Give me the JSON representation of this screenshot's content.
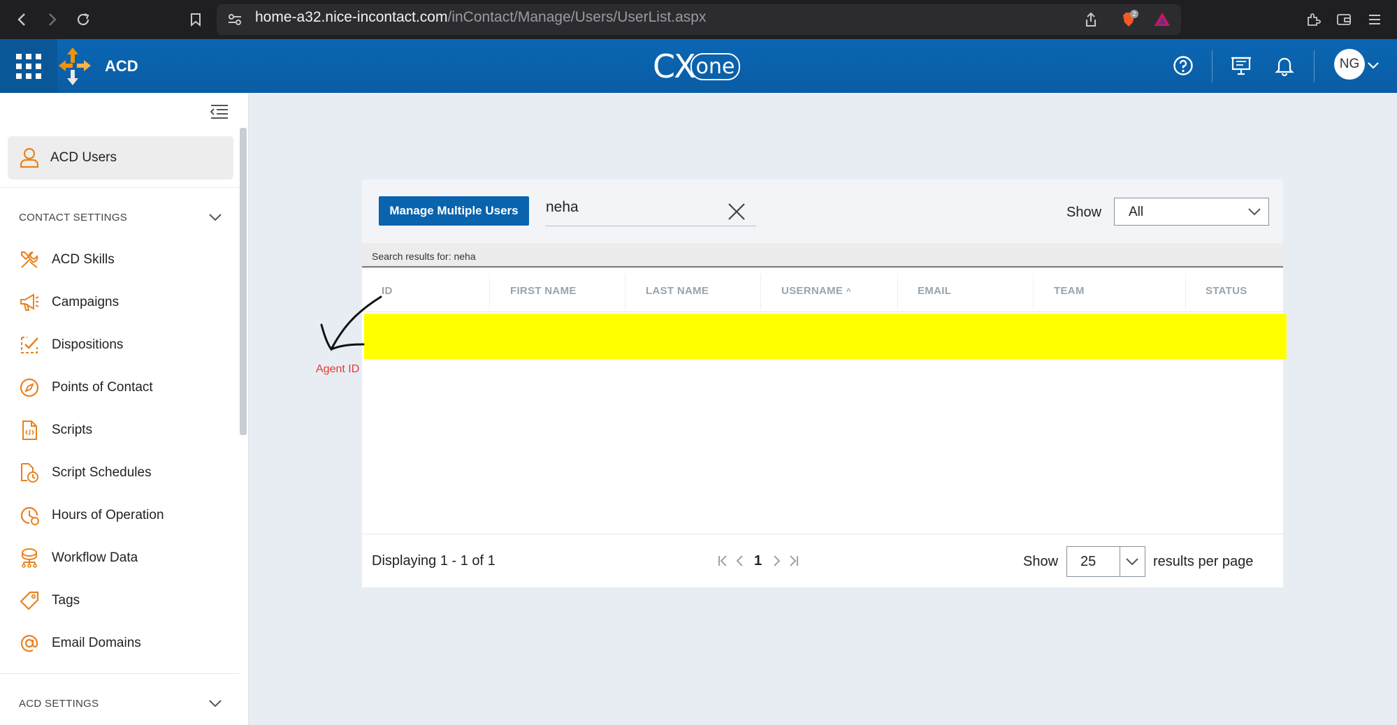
{
  "browser": {
    "url_domain": "home-a32.nice-incontact.com",
    "url_path": "/inContact/Manage/Users/UserList.aspx",
    "shield_badge": "2"
  },
  "header": {
    "app_name": "ACD",
    "brand_cx": "CX",
    "brand_one": "one",
    "user_initials": "NG"
  },
  "sidebar": {
    "active_item": "ACD Users",
    "contact_settings_label": "CONTACT SETTINGS",
    "items": [
      {
        "label": "ACD Skills",
        "icon": "tools-icon"
      },
      {
        "label": "Campaigns",
        "icon": "megaphone-icon"
      },
      {
        "label": "Dispositions",
        "icon": "checklist-icon"
      },
      {
        "label": "Points of Contact",
        "icon": "compass-icon"
      },
      {
        "label": "Scripts",
        "icon": "script-file-icon"
      },
      {
        "label": "Script Schedules",
        "icon": "script-schedule-icon"
      },
      {
        "label": "Hours of Operation",
        "icon": "clock-icon"
      },
      {
        "label": "Workflow Data",
        "icon": "workflow-icon"
      },
      {
        "label": "Tags",
        "icon": "tag-icon"
      },
      {
        "label": "Email Domains",
        "icon": "at-icon"
      }
    ],
    "acd_settings_label": "ACD SETTINGS"
  },
  "toolbar": {
    "manage_multiple_label": "Manage Multiple Users",
    "search_value": "neha",
    "show_label": "Show",
    "show_value": "All"
  },
  "results": {
    "search_results_text": "Search results for:  neha"
  },
  "table": {
    "columns": [
      "ID",
      "FIRST NAME",
      "LAST NAME",
      "USERNAME",
      "EMAIL",
      "TEAM",
      "STATUS"
    ],
    "sort_indicator": "^"
  },
  "footer": {
    "displaying_text": "Displaying 1 - 1 of 1",
    "current_page": "1",
    "show_label": "Show",
    "per_page_value": "25",
    "per_page_suffix": "results per page"
  },
  "annotation": {
    "label": "Agent ID"
  },
  "colors": {
    "header_blue": "#0a63ad",
    "highlight_yellow": "#ffff00",
    "accent_orange": "#e8821e",
    "annotation_red": "#e53935"
  }
}
